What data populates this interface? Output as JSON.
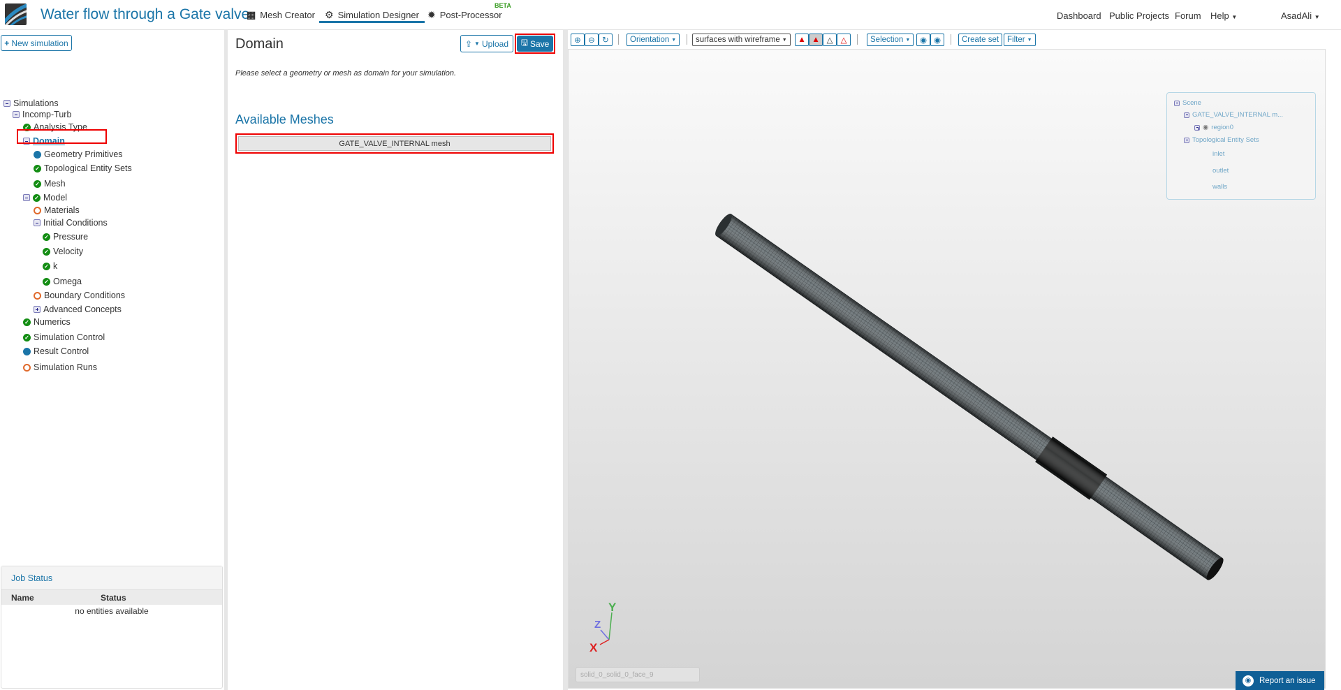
{
  "header": {
    "title": "Water flow through a Gate valve",
    "tabs": [
      {
        "label": "Mesh Creator",
        "icon": "grid-icon"
      },
      {
        "label": "Simulation Designer",
        "icon": "gears-icon"
      },
      {
        "label": "Post-Processor",
        "icon": "cog-icon"
      }
    ],
    "beta": "BETA",
    "right": {
      "dashboard": "Dashboard",
      "public_projects": "Public Projects",
      "forum": "Forum",
      "help": "Help",
      "user": "AsadAli"
    }
  },
  "left": {
    "new_simulation": "New simulation",
    "tree": [
      {
        "label": "Simulations",
        "status": "minus"
      },
      {
        "label": "Incomp-Turb",
        "status": "minus"
      },
      {
        "label": "Analysis Type",
        "status": "ok"
      },
      {
        "label": "Domain",
        "status": "minus"
      },
      {
        "label": "Geometry Primitives",
        "status": "dot"
      },
      {
        "label": "Topological Entity Sets",
        "status": "ok"
      },
      {
        "label": "Mesh",
        "status": "ok"
      },
      {
        "label": "Model",
        "status": "ok"
      },
      {
        "label": "Materials",
        "status": "ring"
      },
      {
        "label": "Initial Conditions",
        "status": "minus"
      },
      {
        "label": "Pressure",
        "status": "ok"
      },
      {
        "label": "Velocity",
        "status": "ok"
      },
      {
        "label": "k",
        "status": "ok"
      },
      {
        "label": "Omega",
        "status": "ok"
      },
      {
        "label": "Boundary Conditions",
        "status": "ring"
      },
      {
        "label": "Advanced Concepts",
        "status": "plus"
      },
      {
        "label": "Numerics",
        "status": "ok"
      },
      {
        "label": "Simulation Control",
        "status": "ok"
      },
      {
        "label": "Result Control",
        "status": "dot"
      },
      {
        "label": "Simulation Runs",
        "status": "ring"
      }
    ],
    "job_status": {
      "title": "Job Status",
      "col_name": "Name",
      "col_status": "Status",
      "empty": "no entities available"
    }
  },
  "middle": {
    "title": "Domain",
    "upload": "Upload",
    "save": "Save",
    "instruction": "Please select a geometry or mesh as domain for your simulation.",
    "available_meshes": "Available Meshes",
    "mesh_button": "GATE_VALVE_INTERNAL mesh"
  },
  "viewer": {
    "orientation": "Orientation",
    "render_mode": "surfaces with wireframe",
    "selection": "Selection",
    "create_set": "Create set",
    "filter": "Filter",
    "scene": {
      "root": "Scene",
      "mesh": "GATE_VALVE_INTERNAL m...",
      "region": "region0",
      "sets": "Topological Entity Sets",
      "items": [
        "inlet",
        "outlet",
        "walls"
      ]
    },
    "axes": {
      "x": "X",
      "y": "Y",
      "z": "Z"
    },
    "face_label": "solid_0_solid_0_face_9",
    "report": "Report an issue"
  },
  "colors": {
    "accent": "#1b75a8",
    "ok": "#138d13",
    "warn": "#e06a2c",
    "highlight": "#e00000"
  }
}
